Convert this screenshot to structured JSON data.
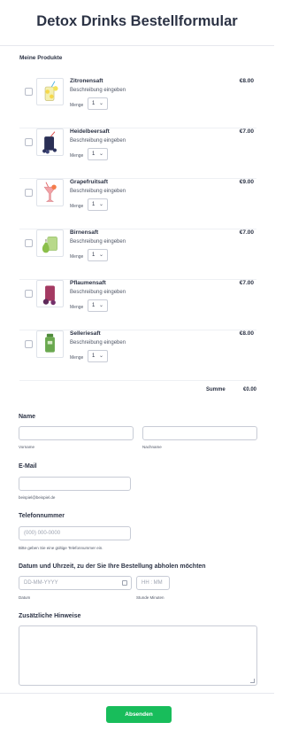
{
  "form": {
    "title": "Detox Drinks Bestellformular",
    "products_label": "Meine Produkte"
  },
  "products": [
    {
      "name": "Zitronensaft",
      "desc": "Beschreibung eingeben",
      "qty_label": "Menge",
      "qty": "1",
      "price": "€8.00",
      "icon": "lemon-drink-icon"
    },
    {
      "name": "Heidelbeersaft",
      "desc": "Beschreibung eingeben",
      "qty_label": "Menge",
      "qty": "1",
      "price": "€7.00",
      "icon": "blueberry-drink-icon"
    },
    {
      "name": "Grapefruitsaft",
      "desc": "Beschreibung eingeben",
      "qty_label": "Menge",
      "qty": "1",
      "price": "€9.00",
      "icon": "grapefruit-drink-icon"
    },
    {
      "name": "Birnensaft",
      "desc": "Beschreibung eingeben",
      "qty_label": "Menge",
      "qty": "1",
      "price": "€7.00",
      "icon": "pear-drink-icon"
    },
    {
      "name": "Pflaumensaft",
      "desc": "Beschreibung eingeben",
      "qty_label": "Menge",
      "qty": "1",
      "price": "€7.00",
      "icon": "plum-drink-icon"
    },
    {
      "name": "Selleriesaft",
      "desc": "Beschreibung eingeben",
      "qty_label": "Menge",
      "qty": "1",
      "price": "€8.00",
      "icon": "celery-drink-icon"
    }
  ],
  "summary": {
    "label": "Summe",
    "value": "€0.00"
  },
  "name_field": {
    "label": "Name",
    "first_sub": "Vorname",
    "last_sub": "Nachname"
  },
  "email_field": {
    "label": "E-Mail",
    "sub": "beispiel@beispiel.de"
  },
  "phone_field": {
    "label": "Telefonnummer",
    "placeholder": "(000) 000-0000",
    "sub": "Bitte geben Sie eine gültige Telefonnummer ein."
  },
  "datetime_field": {
    "label": "Datum und Uhrzeit, zu der Sie Ihre Bestellung abholen möchten",
    "date_placeholder": "DD-MM-YYYY",
    "date_sub": "Datum",
    "time_placeholder": "HH : MM",
    "time_sub": "Stunde Minuten"
  },
  "notes_field": {
    "label": "Zusätzliche Hinweise"
  },
  "submit": {
    "label": "Absenden"
  },
  "colors": {
    "accent": "#18bd5b",
    "text": "#2c3345",
    "border": "#c8ccd6"
  }
}
